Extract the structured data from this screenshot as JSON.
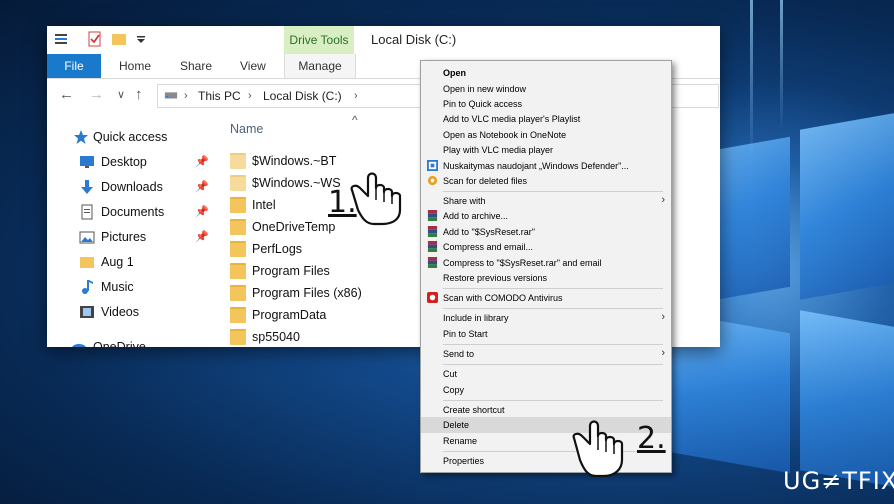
{
  "window": {
    "title": "Local Disk (C:)",
    "context_tab": "Drive Tools",
    "ribbon_tabs": [
      "File",
      "Home",
      "Share",
      "View",
      "Manage"
    ]
  },
  "address": {
    "crumbs": [
      "This PC",
      "Local Disk (C:)"
    ]
  },
  "nav_pane": {
    "items": [
      {
        "label": "Quick access",
        "icon": "star-icon"
      },
      {
        "label": "Desktop",
        "icon": "desktop-icon"
      },
      {
        "label": "Downloads",
        "icon": "download-icon"
      },
      {
        "label": "Documents",
        "icon": "documents-icon"
      },
      {
        "label": "Pictures",
        "icon": "pictures-icon"
      },
      {
        "label": "Aug 1",
        "icon": "folder-icon"
      },
      {
        "label": "Music",
        "icon": "music-icon"
      },
      {
        "label": "Videos",
        "icon": "videos-icon"
      },
      {
        "label": "OneDrive",
        "icon": "onedrive-icon"
      }
    ]
  },
  "content": {
    "column_header": "Name",
    "files": [
      "$Windows.~BT",
      "$Windows.~WS",
      "Intel",
      "OneDriveTemp",
      "PerfLogs",
      "Program Files",
      "Program Files (x86)",
      "ProgramData",
      "sp55040"
    ]
  },
  "context_menu": {
    "items": [
      "Open",
      "Open in new window",
      "Pin to Quick access",
      "Add to VLC media player's Playlist",
      "Open as Notebook in OneNote",
      "Play with VLC media player",
      "Nuskaitymas naudojant „Windows Defender\"...",
      "Scan for deleted files",
      "Share with",
      "Add to archive...",
      "Add to \"$SysReset.rar\"",
      "Compress and email...",
      "Compress to \"$SysReset.rar\" and email",
      "Restore previous versions",
      "Scan with COMODO Antivirus",
      "Include in library",
      "Pin to Start",
      "Send to",
      "Cut",
      "Copy",
      "Create shortcut",
      "Delete",
      "Rename",
      "Properties"
    ]
  },
  "annotations": {
    "step1": "1.",
    "step2": "2."
  },
  "watermark": "UG≠TFIX",
  "colors": {
    "file_tab": "#1979ca",
    "drive_tools_bg": "#d8efc4",
    "folder": "#f3c55a",
    "menu_highlight": "#d9d9d9"
  }
}
